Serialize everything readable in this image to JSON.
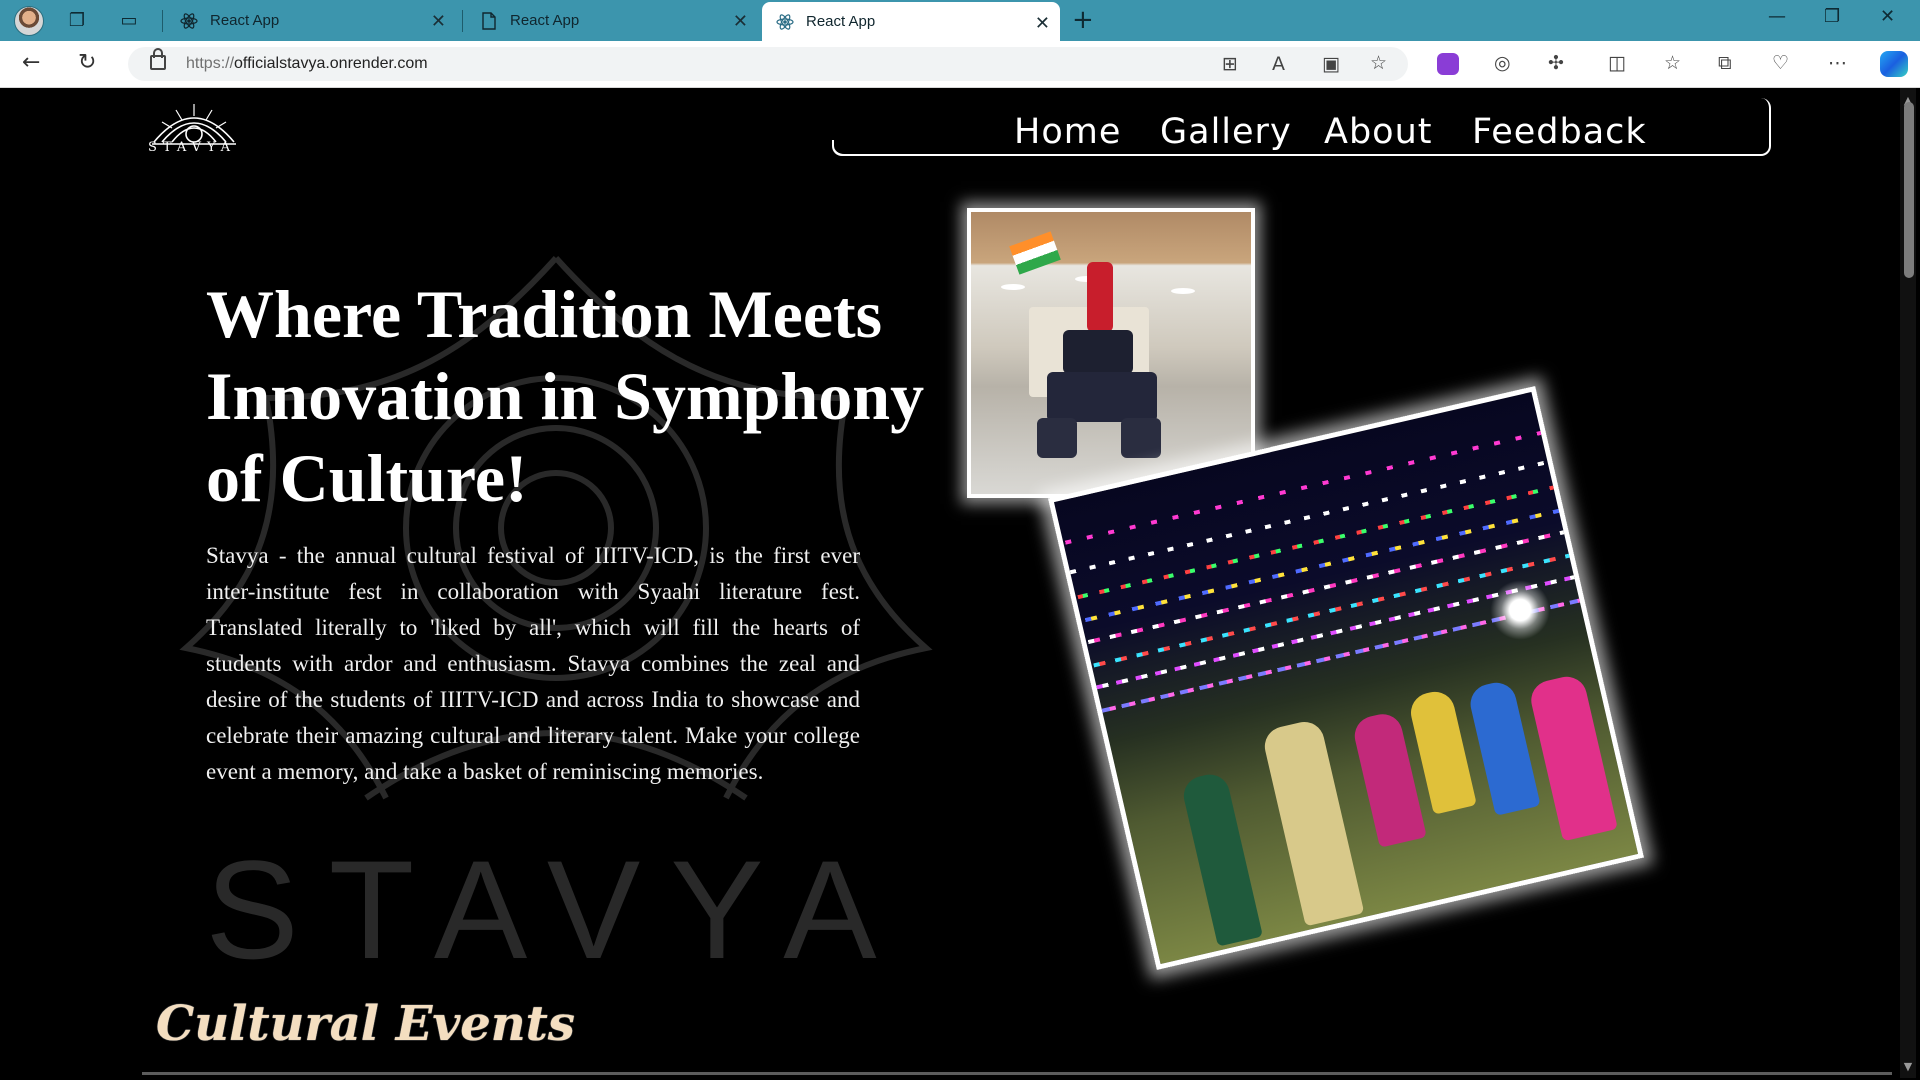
{
  "browser": {
    "tabs": [
      {
        "title": "React App",
        "icon": "react-icon",
        "active": false
      },
      {
        "title": "React App",
        "icon": "page-icon",
        "active": false
      },
      {
        "title": "React App",
        "icon": "react-icon",
        "active": true
      }
    ],
    "address": {
      "scheme": "https://",
      "host": "officialstavya.onrender.com"
    }
  },
  "site": {
    "logo_text": "STAVYA",
    "nav": [
      {
        "label": "Home"
      },
      {
        "label": "Gallery"
      },
      {
        "label": "About"
      },
      {
        "label": "Feedback"
      }
    ],
    "hero": {
      "title": "Where Tradition Meets Innovation in Symphony of Culture!",
      "description": "Stavya - the annual cultural festival of IIITV-ICD, is the first ever inter-institute fest in collaboration with Syaahi literature fest. Translated literally to 'liked by all', which will fill the hearts of students with ardor and enthusiasm. Stavya combines the zeal and desire of the students of IIITV-ICD and across India to showcase and celebrate their amazing cultural and literary talent. Make your college event a memory, and take a basket of reminiscing memories."
    },
    "section_title": "Cultural Events"
  },
  "colors": {
    "tabbar": "#3c95ad",
    "page_bg": "#000000",
    "section_title": "#f4dec0"
  }
}
